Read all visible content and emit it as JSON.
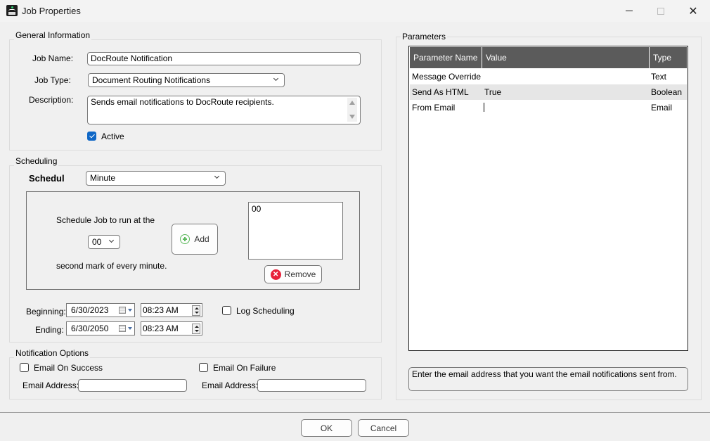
{
  "window": {
    "title": "Job Properties",
    "controls": {
      "minimize": "minimize",
      "maximize": "maximize",
      "close": "✕"
    }
  },
  "general": {
    "group_label": "General Information",
    "job_name_label": "Job Name:",
    "job_name_value": "DocRoute Notification",
    "job_type_label": "Job Type:",
    "job_type_value": "Document Routing Notifications",
    "description_label": "Description:",
    "description_value": "Sends email notifications to DocRoute recipients.",
    "active_label": "Active",
    "active_checked": true
  },
  "scheduling": {
    "group_label": "Scheduling",
    "schedule_label": "Schedule",
    "schedule_value": "Minute",
    "run_text_top": "Schedule Job to run at the",
    "second_value": "00",
    "run_text_bottom": "second mark of every minute.",
    "add_label": "Add",
    "list_items": [
      "00"
    ],
    "remove_label": "Remove",
    "beginning_label": "Beginning:",
    "beginning_date": "6/30/2023",
    "beginning_time": "08:23 AM",
    "ending_label": "Ending:",
    "ending_date": "6/30/2050",
    "ending_time": "08:23 AM",
    "log_label": "Log Scheduling",
    "log_checked": false
  },
  "notification": {
    "group_label": "Notification Options",
    "success_label": "Email On Success",
    "success_checked": false,
    "failure_label": "Email On Failure",
    "failure_checked": false,
    "success_email_label": "Email Address:",
    "success_email_value": "",
    "failure_email_label": "Email Address:",
    "failure_email_value": ""
  },
  "parameters": {
    "group_label": "Parameters",
    "columns": [
      "Parameter Name",
      "Value",
      "Type"
    ],
    "rows": [
      {
        "name": "Message Override",
        "value": "",
        "type": "Text"
      },
      {
        "name": "Send As HTML",
        "value": "True",
        "type": "Boolean"
      },
      {
        "name": "From Email",
        "value": "",
        "type": "Email"
      }
    ],
    "help_text": "Enter the email address that you want the email notifications sent from."
  },
  "footer": {
    "ok_label": "OK",
    "cancel_label": "Cancel"
  },
  "colors": {
    "accent": "#0f67c6",
    "add_icon": "#5cb85c",
    "remove_icon": "#e8213a",
    "grid_header": "#5b5b5b"
  }
}
